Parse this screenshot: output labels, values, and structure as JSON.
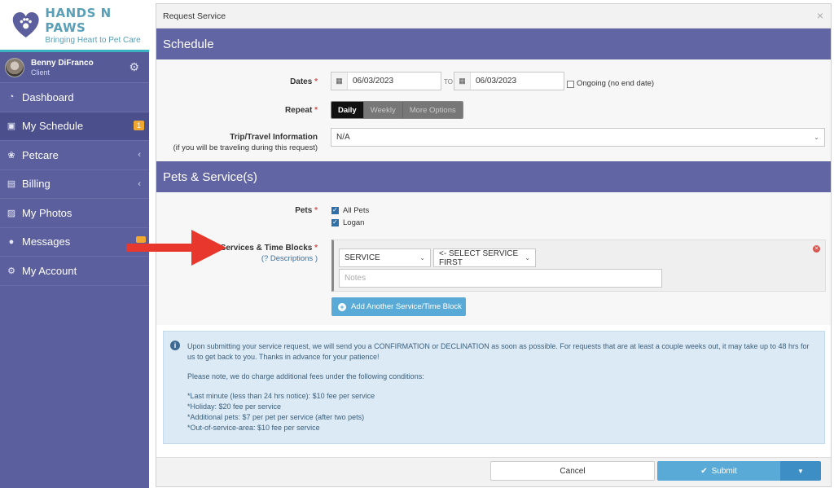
{
  "brand": {
    "title": "HANDS N PAWS",
    "tagline": "Bringing Heart to Pet Care",
    "accent": "#5b5f9e",
    "logo_color": "#5a9fb8"
  },
  "user": {
    "name": "Benny DiFranco",
    "role": "Client"
  },
  "nav": {
    "items": [
      {
        "label": "Dashboard",
        "icon": "dashboard-icon"
      },
      {
        "label": "My Schedule",
        "icon": "calendar-icon",
        "badge": "1"
      },
      {
        "label": "Petcare",
        "icon": "paw-icon"
      },
      {
        "label": "Billing",
        "icon": "document-icon"
      },
      {
        "label": "My Photos",
        "icon": "photo-icon"
      },
      {
        "label": "Messages",
        "icon": "chat-icon"
      },
      {
        "label": "My Account",
        "icon": "gears-icon"
      }
    ],
    "chevron": "‹"
  },
  "modal": {
    "title": "Request Service",
    "close": "×",
    "schedule": {
      "heading": "Schedule",
      "dates_label": "Dates",
      "required": "*",
      "date_from": "06/03/2023",
      "to": "TO",
      "date_to": "06/03/2023",
      "ongoing_label": "Ongoing (no end date)",
      "repeat_label": "Repeat",
      "repeat_options": [
        "Daily",
        "Weekly",
        "More Options"
      ],
      "trip_label": "Trip/Travel Information",
      "trip_sublabel": "(if you will be traveling during this request)",
      "trip_value": "N/A"
    },
    "pets": {
      "heading": "Pets & Service(s)",
      "pets_label": "Pets",
      "pet_options": [
        "All Pets",
        "Logan"
      ],
      "services_label": "Services & Time Blocks",
      "descriptions_link": "Descriptions",
      "service_select": "SERVICE",
      "time_select": "<- SELECT SERVICE FIRST",
      "notes_placeholder": "Notes",
      "add_button": "Add Another Service/Time Block"
    },
    "info": {
      "paragraph1": "Upon submitting your service request, we will send you a CONFIRMATION or DECLINATION as soon as possible. For requests that are at least a couple weeks out, it may take up to 48 hrs for us to get back to you. Thanks in advance for your patience!",
      "paragraph2": "Please note, we do charge additional fees under the following conditions:",
      "fees": [
        "*Last minute (less than 24 hrs notice): $10 fee per service",
        "*Holiday: $20 fee per service",
        "*Additional pets: $7 per pet per service (after two pets)",
        "*Out-of-service-area: $10 fee per service"
      ]
    },
    "footer": {
      "cancel": "Cancel",
      "submit": "Submit"
    }
  }
}
